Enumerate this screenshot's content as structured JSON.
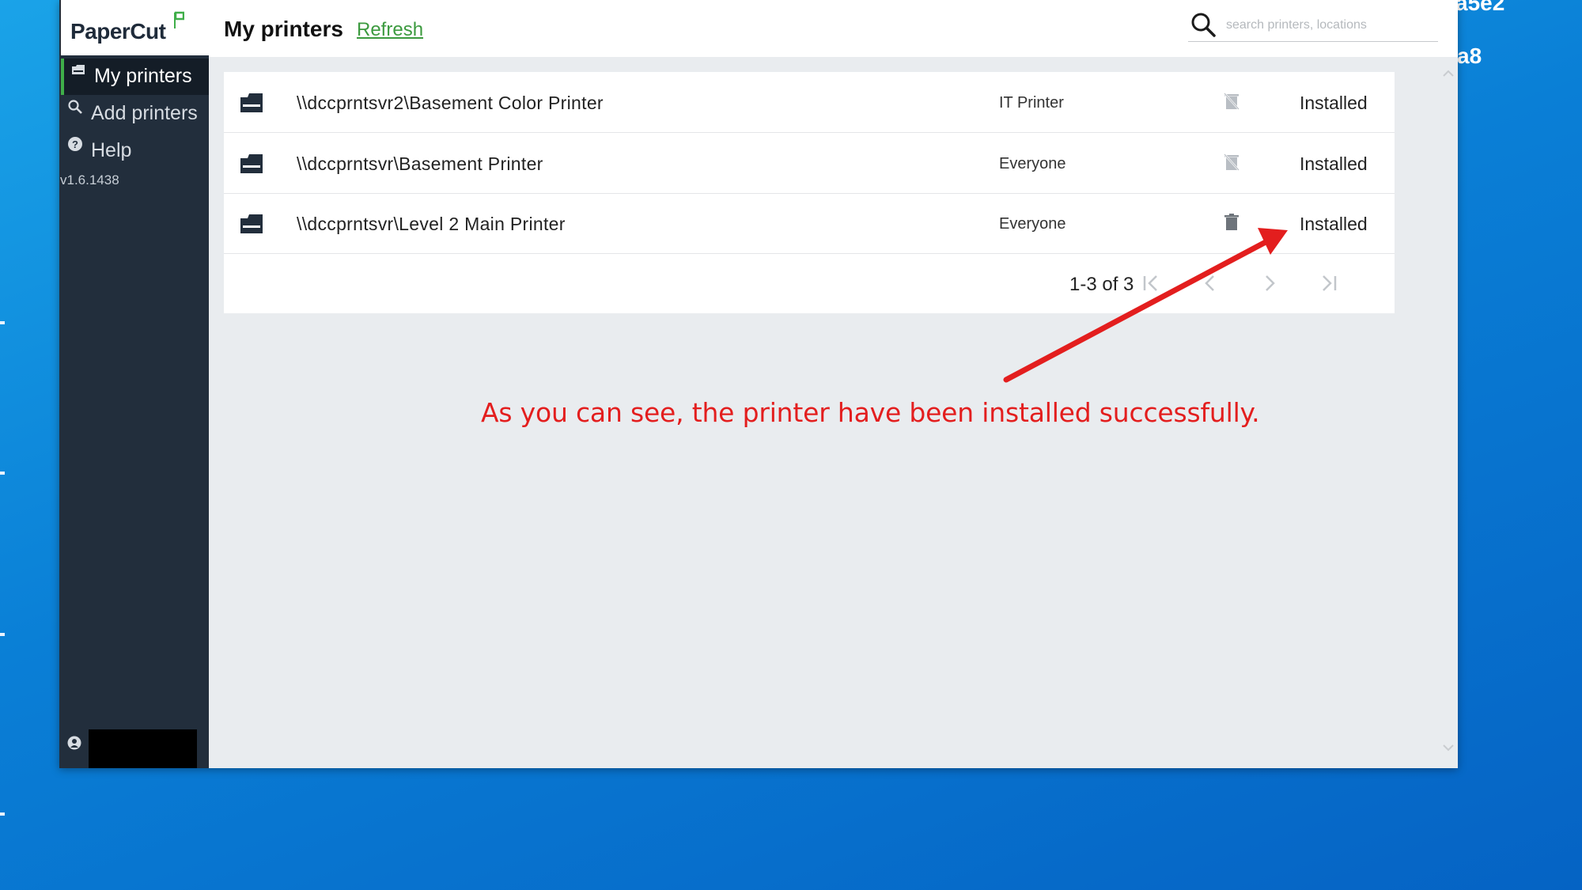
{
  "desktop": {
    "corner_text_1": "a5e2",
    "corner_text_2": "a8"
  },
  "app": {
    "logo": "PaperCut",
    "version": "v1.6.1438",
    "brand_color": "#3fae49"
  },
  "sidebar": {
    "items": [
      {
        "label": "My printers",
        "icon": "printer-icon",
        "active": true
      },
      {
        "label": "Add printers",
        "icon": "search-icon",
        "active": false
      },
      {
        "label": "Help",
        "icon": "help-icon",
        "active": false
      }
    ]
  },
  "header": {
    "title": "My printers",
    "refresh_label": "Refresh",
    "search_placeholder": "search printers, locations"
  },
  "printers": [
    {
      "name": "\\\\dccprntsvr2\\Basement Color Printer",
      "group": "IT Printer",
      "delete_enabled": false,
      "status": "Installed"
    },
    {
      "name": "\\\\dccprntsvr\\Basement Printer",
      "group": "Everyone",
      "delete_enabled": false,
      "status": "Installed"
    },
    {
      "name": "\\\\dccprntsvr\\Level 2 Main Printer",
      "group": "Everyone",
      "delete_enabled": true,
      "status": "Installed"
    }
  ],
  "pagination": {
    "range_label": "1-3 of 3"
  },
  "annotation": {
    "text": "As you can see, the printer have been installed successfully.",
    "color": "#e31e1e"
  }
}
